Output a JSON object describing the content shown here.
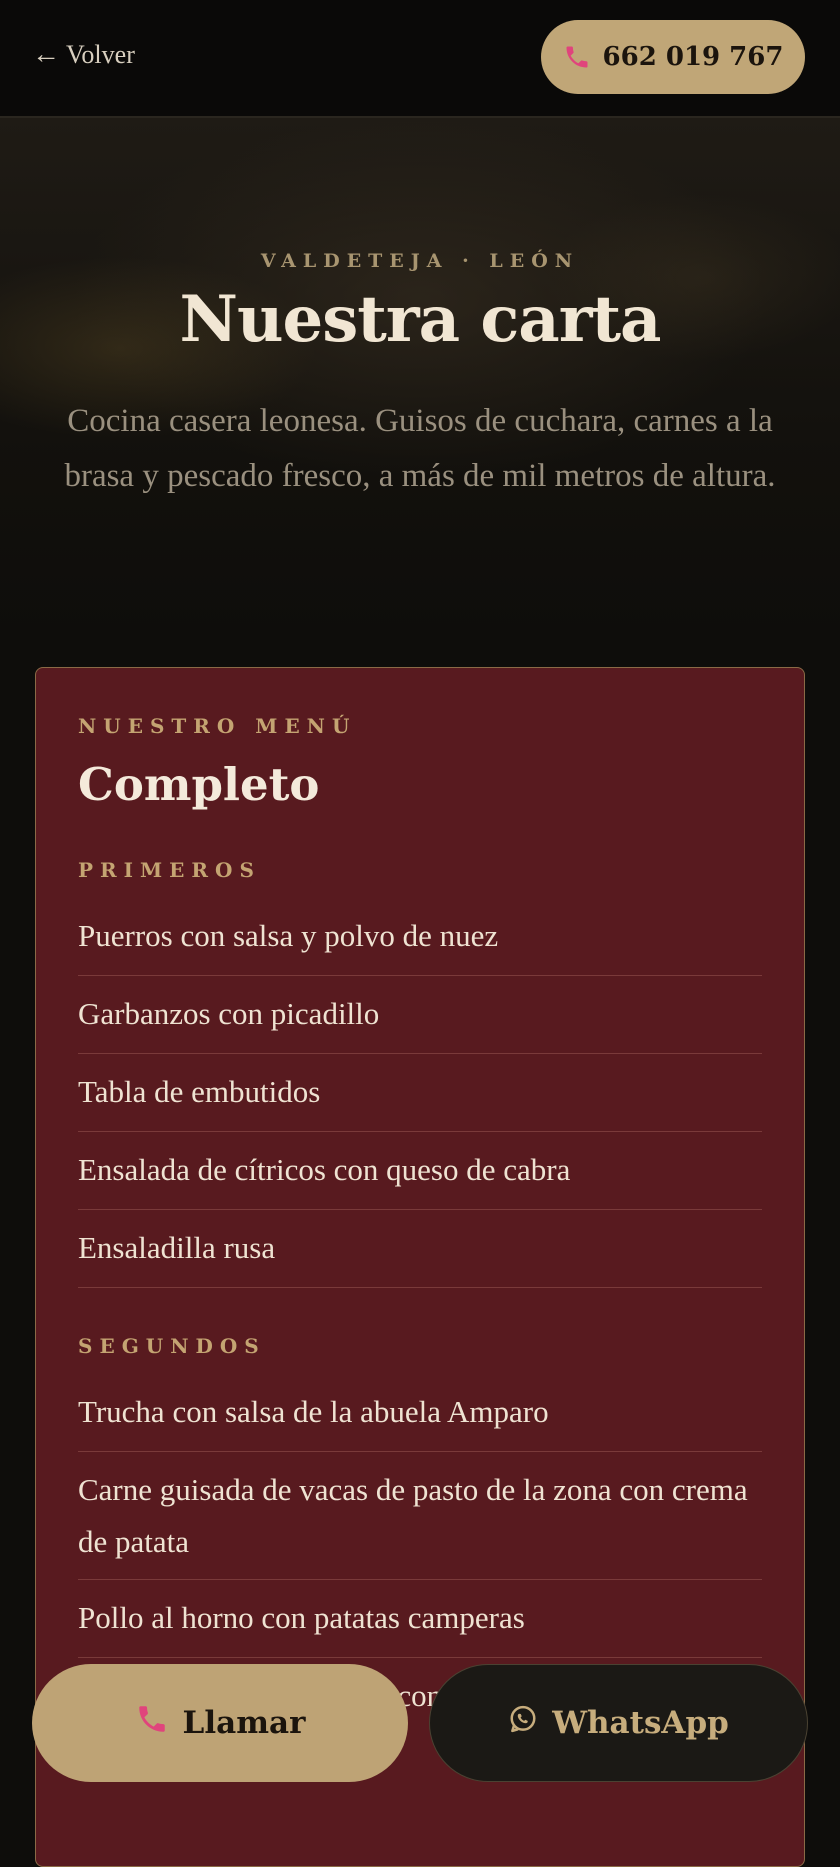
{
  "header": {
    "back_label": "Volver",
    "back_arrow": "←",
    "phone_label": "662 019 767",
    "phone_icon": "phone-icon"
  },
  "hero": {
    "eyebrow": "VALDETEJA · LEÓN",
    "title": "Nuestra carta",
    "intro": "Cocina casera leonesa. Guisos de cuchara, carnes a la brasa y pescado fresco, a más de mil metros de altura."
  },
  "menu": {
    "eyebrow": "NUESTRO MENÚ",
    "title": "Completo",
    "sections": [
      {
        "label": "PRIMEROS",
        "items": [
          "Puerros con salsa y polvo de nuez",
          "Garbanzos con picadillo",
          "Tabla de embutidos",
          "Ensalada de cítricos con queso de cabra",
          "Ensaladilla rusa"
        ]
      },
      {
        "label": "SEGUNDOS",
        "items": [
          "Trucha con salsa de la abuela Amparo",
          "Carne guisada de vacas de pasto de la zona con crema de patata",
          "Pollo al horno con patatas camperas",
          "Lomo de hornera de casa con pisto y huevo"
        ]
      }
    ]
  },
  "cta": {
    "call_label": "Llamar",
    "whatsapp_label": "WhatsApp"
  },
  "colors": {
    "accent": "#c0a677",
    "card_bg": "#581a1f",
    "page_bg": "#0e0d0b",
    "phone_icon": "#e0447c"
  }
}
